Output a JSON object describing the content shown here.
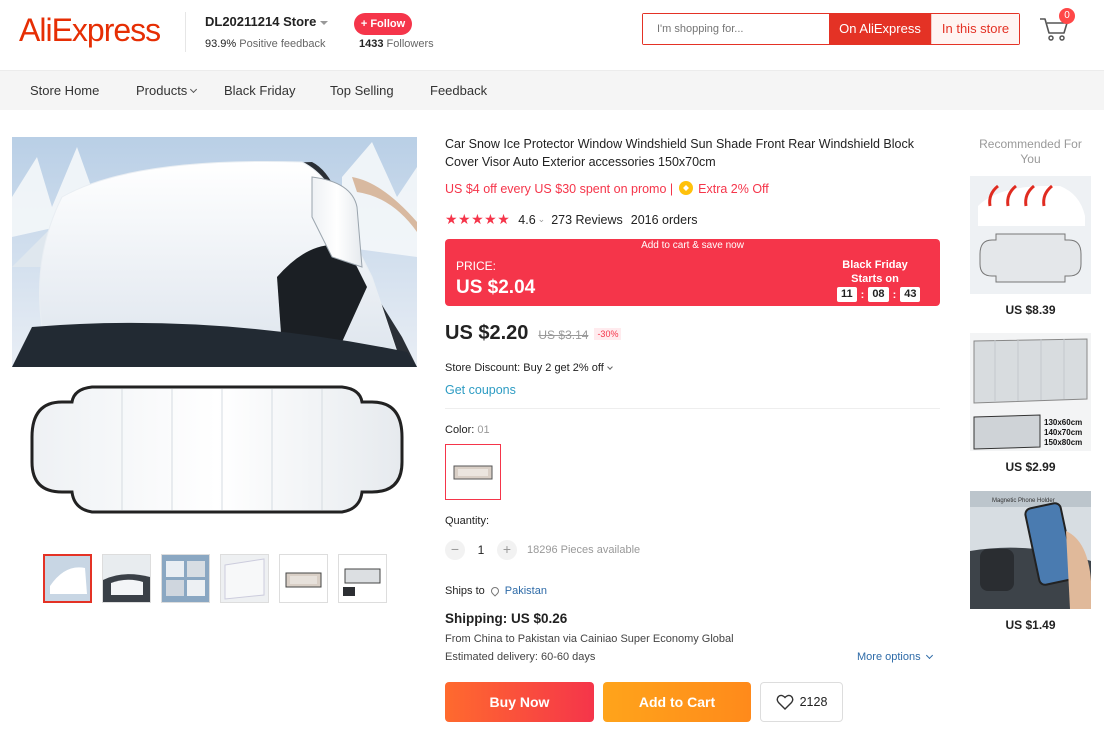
{
  "header": {
    "logo": "AliExpress",
    "store_name": "DL20211214 Store",
    "feedback_pct": "93.9%",
    "feedback_label": "Positive feedback",
    "follow_label": "+ Follow",
    "followers_count": "1433",
    "followers_label": "Followers",
    "search_placeholder": "I'm shopping for...",
    "search_ali": "On AliExpress",
    "search_store": "In this store",
    "cart_count": "0"
  },
  "nav": [
    "Store Home",
    "Products",
    "Black Friday",
    "Top Selling",
    "Feedback"
  ],
  "product": {
    "title": "Car Snow Ice Protector Window Windshield Sun Shade Front Rear Windshield Block Cover Visor Auto Exterior accessories 150x70cm",
    "promo": "US $4 off every US $30 spent on promo",
    "promo_sep": "|",
    "promo_extra": "Extra 2% Off",
    "stars": "★★★★★",
    "rating": "4.6",
    "rating_value": 4.6,
    "reviews": "273 Reviews",
    "orders": "2016 orders",
    "deal_head": "Add to cart & save now",
    "deal_price_label": "PRICE:",
    "deal_price": "US $2.04",
    "deal_bf_1": "Black Friday",
    "deal_bf_2": "Starts on",
    "countdown": [
      "11",
      "08",
      "43"
    ],
    "countdown_sep": ":",
    "price": "US $2.20",
    "orig_price": "US $3.14",
    "discount": "-30%",
    "store_discount": "Store Discount: Buy 2 get 2% off",
    "coupons": "Get coupons",
    "color_label": "Color:",
    "color_value": "01",
    "qty_label": "Quantity:",
    "qty_minus": "−",
    "qty_value": "1",
    "qty_plus": "+",
    "qty_avail": "18296 Pieces available",
    "ships_to_label": "Ships to",
    "ships_to_country": "Pakistan",
    "shipping": "Shipping: US $0.26",
    "ship_route": "From China to Pakistan via Cainiao Super Economy Global",
    "ship_delivery": "Estimated delivery: 60-60 days",
    "more_options": "More options",
    "buy_now": "Buy Now",
    "add_to_cart": "Add to Cart",
    "wishlist_count": "2128"
  },
  "recommended": {
    "title": "Recommended For You",
    "items": [
      {
        "price": "US $8.39"
      },
      {
        "price": "US $2.99",
        "sizes": [
          "130x60cm",
          "140x70cm",
          "150x80cm"
        ]
      },
      {
        "price": "US $1.49",
        "caption": "Magnetic Phone Holder"
      }
    ]
  },
  "colors": {
    "brand": "#e62e04",
    "accent": "#f5354a",
    "link": "#2e9cc3",
    "orange": "#ff8a1b"
  }
}
